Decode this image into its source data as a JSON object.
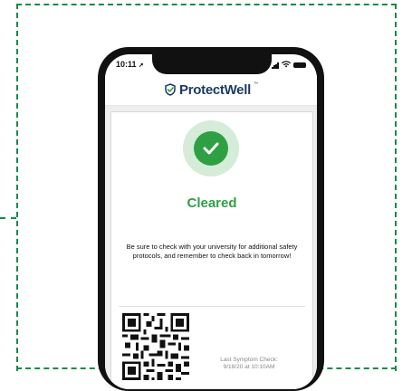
{
  "status_bar": {
    "time": "10:11",
    "location_arrow": "➚"
  },
  "header": {
    "brand": "ProtectWell",
    "trademark": "™",
    "logo_icon": "shield-check-icon"
  },
  "result": {
    "icon": "check-circle-icon",
    "title": "Cleared",
    "message": "Be sure to check with your university for additional safety protocols, and remember to check back in tomorrow!"
  },
  "last_check": {
    "label": "Last Symptom Check:",
    "value": "9/18/20 at 10:10AM"
  },
  "colors": {
    "accent_green": "#2ea043",
    "light_green": "#d5ecd9",
    "brand_navy": "#1e3a5f",
    "dashed_frame": "#1a8a4a"
  }
}
